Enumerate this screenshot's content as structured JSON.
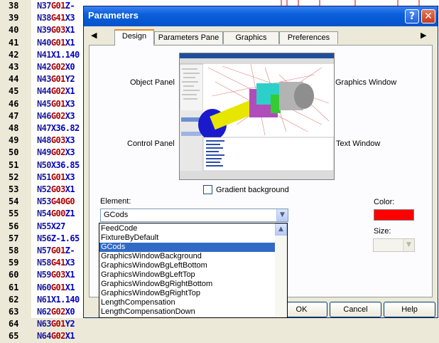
{
  "editor": {
    "lines": [
      {
        "num": "38",
        "parts": [
          [
            "N37",
            "N"
          ],
          [
            "G01",
            "G"
          ],
          [
            "Z-",
            "X"
          ]
        ]
      },
      {
        "num": "39",
        "parts": [
          [
            "N38",
            "N"
          ],
          [
            "G41",
            "G"
          ],
          [
            "X3",
            "X"
          ]
        ]
      },
      {
        "num": "40",
        "parts": [
          [
            "N39",
            "N"
          ],
          [
            "G03",
            "G"
          ],
          [
            "X1",
            "X"
          ]
        ]
      },
      {
        "num": "41",
        "parts": [
          [
            "N40",
            "N"
          ],
          [
            "G01",
            "G"
          ],
          [
            "X1",
            "X"
          ]
        ]
      },
      {
        "num": "42",
        "parts": [
          [
            "N41",
            "N"
          ],
          [
            "X1.140",
            "X"
          ]
        ]
      },
      {
        "num": "43",
        "parts": [
          [
            "N42",
            "N"
          ],
          [
            "G02",
            "G"
          ],
          [
            "X0",
            "X"
          ]
        ]
      },
      {
        "num": "44",
        "parts": [
          [
            "N43",
            "N"
          ],
          [
            "G01",
            "G"
          ],
          [
            "Y2",
            "X"
          ]
        ]
      },
      {
        "num": "45",
        "parts": [
          [
            "N44",
            "N"
          ],
          [
            "G02",
            "G"
          ],
          [
            "X1",
            "X"
          ]
        ]
      },
      {
        "num": "46",
        "parts": [
          [
            "N45",
            "N"
          ],
          [
            "G01",
            "G"
          ],
          [
            "X3",
            "X"
          ]
        ]
      },
      {
        "num": "47",
        "parts": [
          [
            "N46",
            "N"
          ],
          [
            "G02",
            "G"
          ],
          [
            "X3",
            "X"
          ]
        ]
      },
      {
        "num": "48",
        "parts": [
          [
            "N47",
            "N"
          ],
          [
            "X36.82",
            "X"
          ]
        ]
      },
      {
        "num": "49",
        "parts": [
          [
            "N48",
            "N"
          ],
          [
            "G03",
            "G"
          ],
          [
            "X3",
            "X"
          ]
        ]
      },
      {
        "num": "50",
        "parts": [
          [
            "N49",
            "N"
          ],
          [
            "G02",
            "G"
          ],
          [
            "X3",
            "X"
          ]
        ]
      },
      {
        "num": "51",
        "parts": [
          [
            "N50",
            "N"
          ],
          [
            "X36.85",
            "X"
          ]
        ]
      },
      {
        "num": "52",
        "parts": [
          [
            "N51",
            "N"
          ],
          [
            "G01",
            "G"
          ],
          [
            "X3",
            "X"
          ]
        ]
      },
      {
        "num": "53",
        "parts": [
          [
            "N52",
            "N"
          ],
          [
            "G03",
            "G"
          ],
          [
            "X1",
            "X"
          ]
        ]
      },
      {
        "num": "54",
        "parts": [
          [
            "N53",
            "N"
          ],
          [
            "G40",
            "G"
          ],
          [
            "G0",
            "G"
          ]
        ]
      },
      {
        "num": "55",
        "parts": [
          [
            "N54",
            "N"
          ],
          [
            "G00",
            "G"
          ],
          [
            "Z1",
            "X"
          ]
        ]
      },
      {
        "num": "56",
        "parts": [
          [
            "N55",
            "N"
          ],
          [
            "X27",
            "X"
          ]
        ]
      },
      {
        "num": "57",
        "parts": [
          [
            "N56",
            "N"
          ],
          [
            "Z-1.65",
            "X"
          ]
        ]
      },
      {
        "num": "58",
        "parts": [
          [
            "N57",
            "N"
          ],
          [
            "G01",
            "G"
          ],
          [
            "Z-",
            "X"
          ]
        ]
      },
      {
        "num": "59",
        "parts": [
          [
            "N58",
            "N"
          ],
          [
            "G41",
            "G"
          ],
          [
            "X3",
            "X"
          ]
        ]
      },
      {
        "num": "60",
        "parts": [
          [
            "N59",
            "N"
          ],
          [
            "G03",
            "G"
          ],
          [
            "X1",
            "X"
          ]
        ]
      },
      {
        "num": "61",
        "parts": [
          [
            "N60",
            "N"
          ],
          [
            "G01",
            "G"
          ],
          [
            "X1",
            "X"
          ]
        ]
      },
      {
        "num": "62",
        "parts": [
          [
            "N61",
            "N"
          ],
          [
            "X1.140",
            "X"
          ]
        ]
      },
      {
        "num": "63",
        "parts": [
          [
            "N62",
            "N"
          ],
          [
            "G02",
            "G"
          ],
          [
            "X0",
            "X"
          ]
        ]
      },
      {
        "num": "64",
        "parts": [
          [
            "N63",
            "N"
          ],
          [
            "G01",
            "G"
          ],
          [
            "Y2",
            "X"
          ]
        ]
      },
      {
        "num": "65",
        "parts": [
          [
            "N64",
            "N"
          ],
          [
            "G02",
            "G"
          ],
          [
            "X1",
            "X"
          ]
        ]
      }
    ]
  },
  "dialog": {
    "title": "Parameters",
    "help_glyph": "?",
    "close_glyph": "✕",
    "tabs": [
      "Design",
      "Parameters Pane",
      "Graphics",
      "Preferences"
    ],
    "labels": {
      "object_panel": "Object Panel",
      "graphics_window": "Graphics Window",
      "control_panel": "Control Panel",
      "text_window": "Text Window",
      "gradient_background": "Gradient background",
      "element": "Element:",
      "color": "Color:",
      "size": "Size:"
    },
    "gradient_checked": false,
    "element_value": "GCods",
    "color_value": "#ff0000",
    "dropdown_options": [
      "FeedCode",
      "FixtureByDefault",
      "GCods",
      "GraphicsWindowBackground",
      "GraphicsWindowBgLeftBottom",
      "GraphicsWindowBgLeftTop",
      "GraphicsWindowBgRightBottom",
      "GraphicsWindowBgRightTop",
      "LengthCompensation",
      "LengthCompensationDown"
    ],
    "selected_option": "GCods",
    "buttons": {
      "ok": "OK",
      "cancel": "Cancel",
      "help": "Help"
    }
  },
  "colors": {
    "accent": "#316ac5",
    "titlebar": "#0a5fd9",
    "gcode_red": "#b00000",
    "gcode_blue": "#1c1c9c"
  }
}
